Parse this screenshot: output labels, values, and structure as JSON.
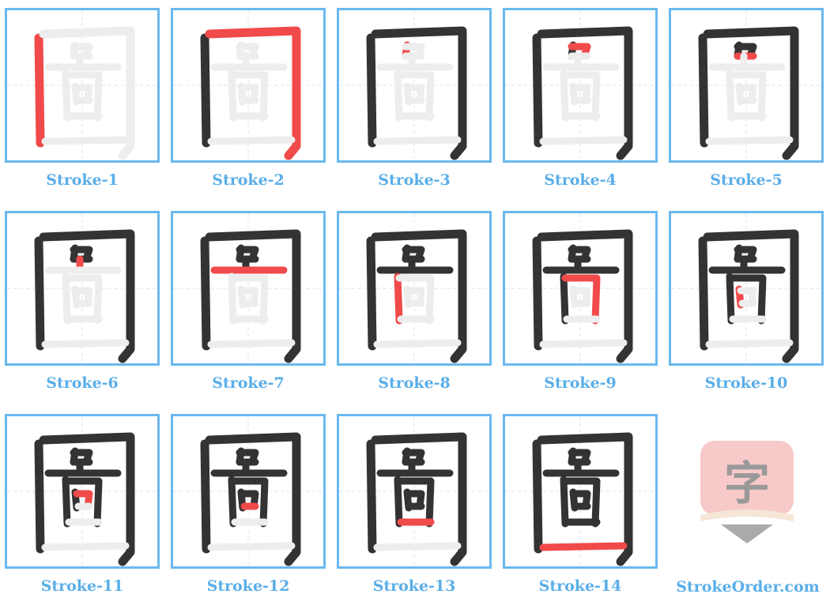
{
  "character": "圖",
  "colors": {
    "border": "#6ab9ee",
    "label": "#5aaee8",
    "ghost": "#ededed",
    "done": "#333333",
    "current": "#f04a4a"
  },
  "cells": [
    {
      "label": "Stroke-1"
    },
    {
      "label": "Stroke-2"
    },
    {
      "label": "Stroke-3"
    },
    {
      "label": "Stroke-4"
    },
    {
      "label": "Stroke-5"
    },
    {
      "label": "Stroke-6"
    },
    {
      "label": "Stroke-7"
    },
    {
      "label": "Stroke-8"
    },
    {
      "label": "Stroke-9"
    },
    {
      "label": "Stroke-10"
    },
    {
      "label": "Stroke-11"
    },
    {
      "label": "Stroke-12"
    },
    {
      "label": "Stroke-13"
    },
    {
      "label": "Stroke-14"
    }
  ],
  "logo": {
    "glyph": "字",
    "icon": "brush-logo-icon"
  },
  "site": {
    "name": "StrokeOrder.com"
  }
}
